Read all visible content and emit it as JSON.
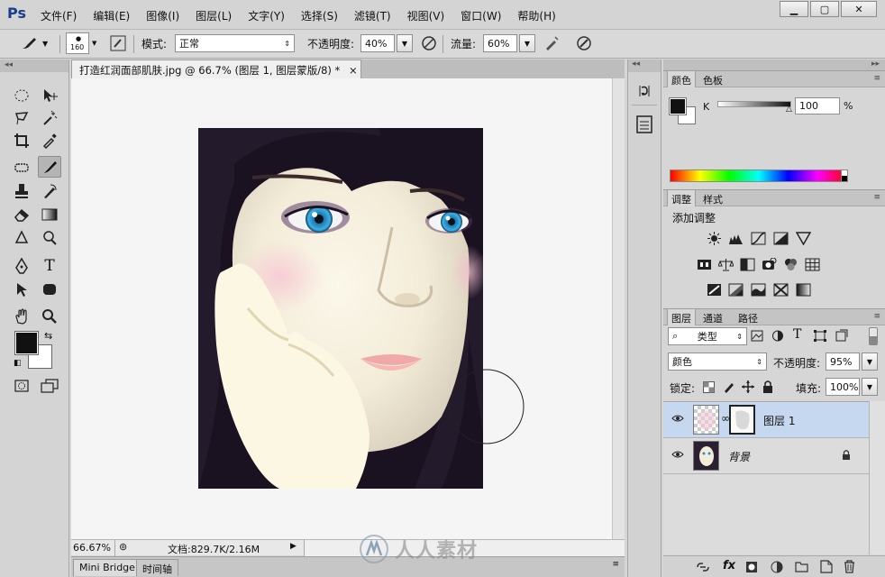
{
  "app": {
    "logo": "Ps",
    "menus": [
      "文件(F)",
      "编辑(E)",
      "图像(I)",
      "图层(L)",
      "文字(Y)",
      "选择(S)",
      "滤镜(T)",
      "视图(V)",
      "窗口(W)",
      "帮助(H)"
    ],
    "window_buttons": [
      "minimize",
      "restore",
      "close"
    ]
  },
  "options": {
    "brush_size": "160",
    "mode_label": "模式:",
    "mode_value": "正常",
    "opacity_label": "不透明度:",
    "opacity_value": "40%",
    "flow_label": "流量:",
    "flow_value": "60%"
  },
  "document": {
    "tab_title": "打造红润面部肌肤.jpg @ 66.7% (图层 1, 图层蒙版/8) *",
    "tab_close": "×",
    "zoom": "66.67%",
    "doc_info": "文档:829.7K/2.16M"
  },
  "bottom_tabs": [
    "Mini Bridge",
    "时间轴"
  ],
  "color_panel": {
    "tabs": [
      "颜色",
      "色板"
    ],
    "channel_label": "K",
    "channel_value": "100",
    "unit": "%"
  },
  "adjustments_panel": {
    "tabs": [
      "调整",
      "样式"
    ],
    "title": "添加调整"
  },
  "layers_panel": {
    "tabs": [
      "图层",
      "通道",
      "路径"
    ],
    "filter_kind": "类型",
    "blend_mode": "颜色",
    "opacity_label": "不透明度:",
    "opacity_value": "95%",
    "lock_label": "锁定:",
    "fill_label": "填充:",
    "fill_value": "100%",
    "layers": [
      {
        "name": "图层 1",
        "selected": true
      },
      {
        "name": "背景",
        "selected": false,
        "locked": true
      }
    ]
  },
  "watermark": "人人素材",
  "colors": {
    "accent": "#1a3e8a",
    "selected_layer": "#c6d7f0",
    "foreground": "#111111",
    "background": "#ffffff"
  }
}
